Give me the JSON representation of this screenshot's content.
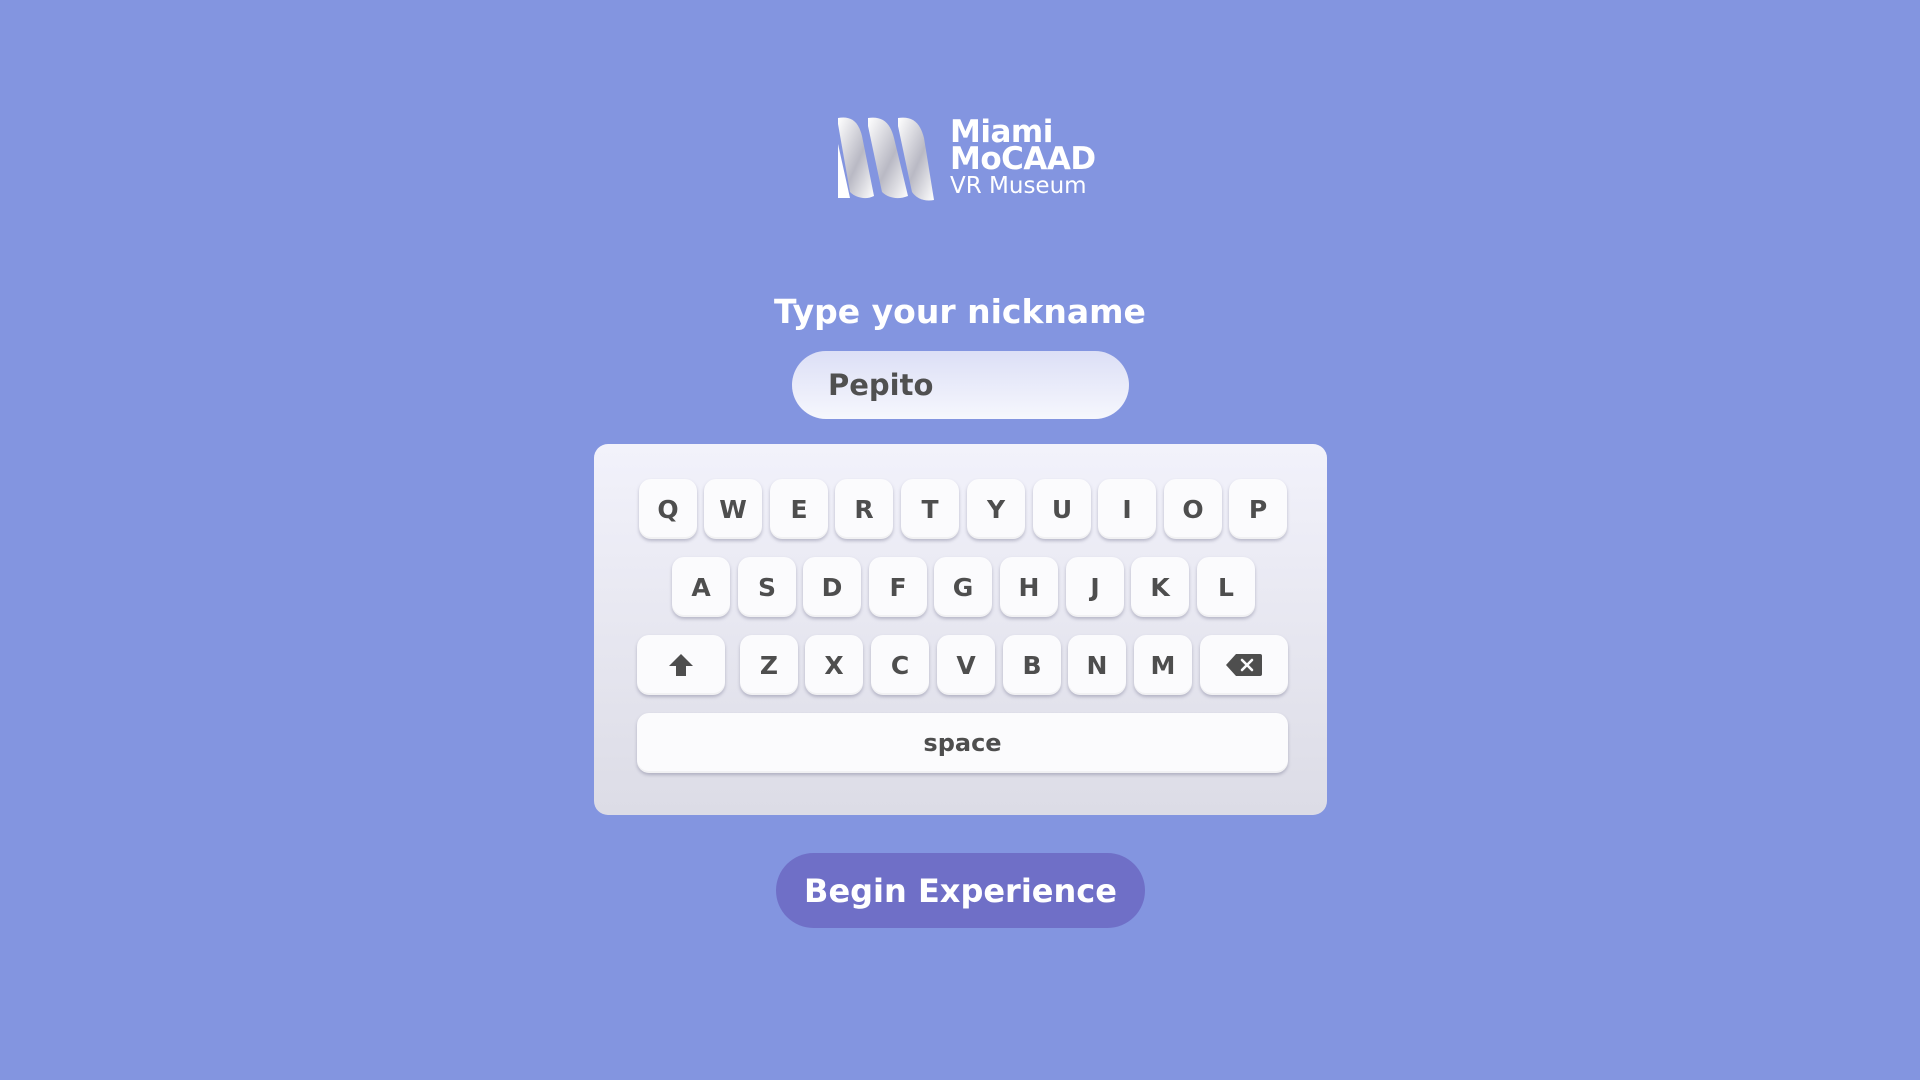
{
  "logo": {
    "line1": "Miami",
    "line2": "MoCAAD",
    "line3": "VR Museum"
  },
  "prompt": "Type your nickname",
  "nickname_field": {
    "value": "Pepito"
  },
  "keyboard": {
    "row1": [
      "Q",
      "W",
      "E",
      "R",
      "T",
      "Y",
      "U",
      "I",
      "O",
      "P"
    ],
    "row2": [
      "A",
      "S",
      "D",
      "F",
      "G",
      "H",
      "J",
      "K",
      "L"
    ],
    "row3": [
      "Z",
      "X",
      "C",
      "V",
      "B",
      "N",
      "M"
    ],
    "shift_icon": "shift-arrow-icon",
    "backspace_icon": "backspace-icon",
    "space_label": "space"
  },
  "begin_button": {
    "label": "Begin Experience"
  },
  "colors": {
    "background": "#8395e0",
    "button": "#6f6fc7",
    "key_text": "#4e4e4e"
  }
}
